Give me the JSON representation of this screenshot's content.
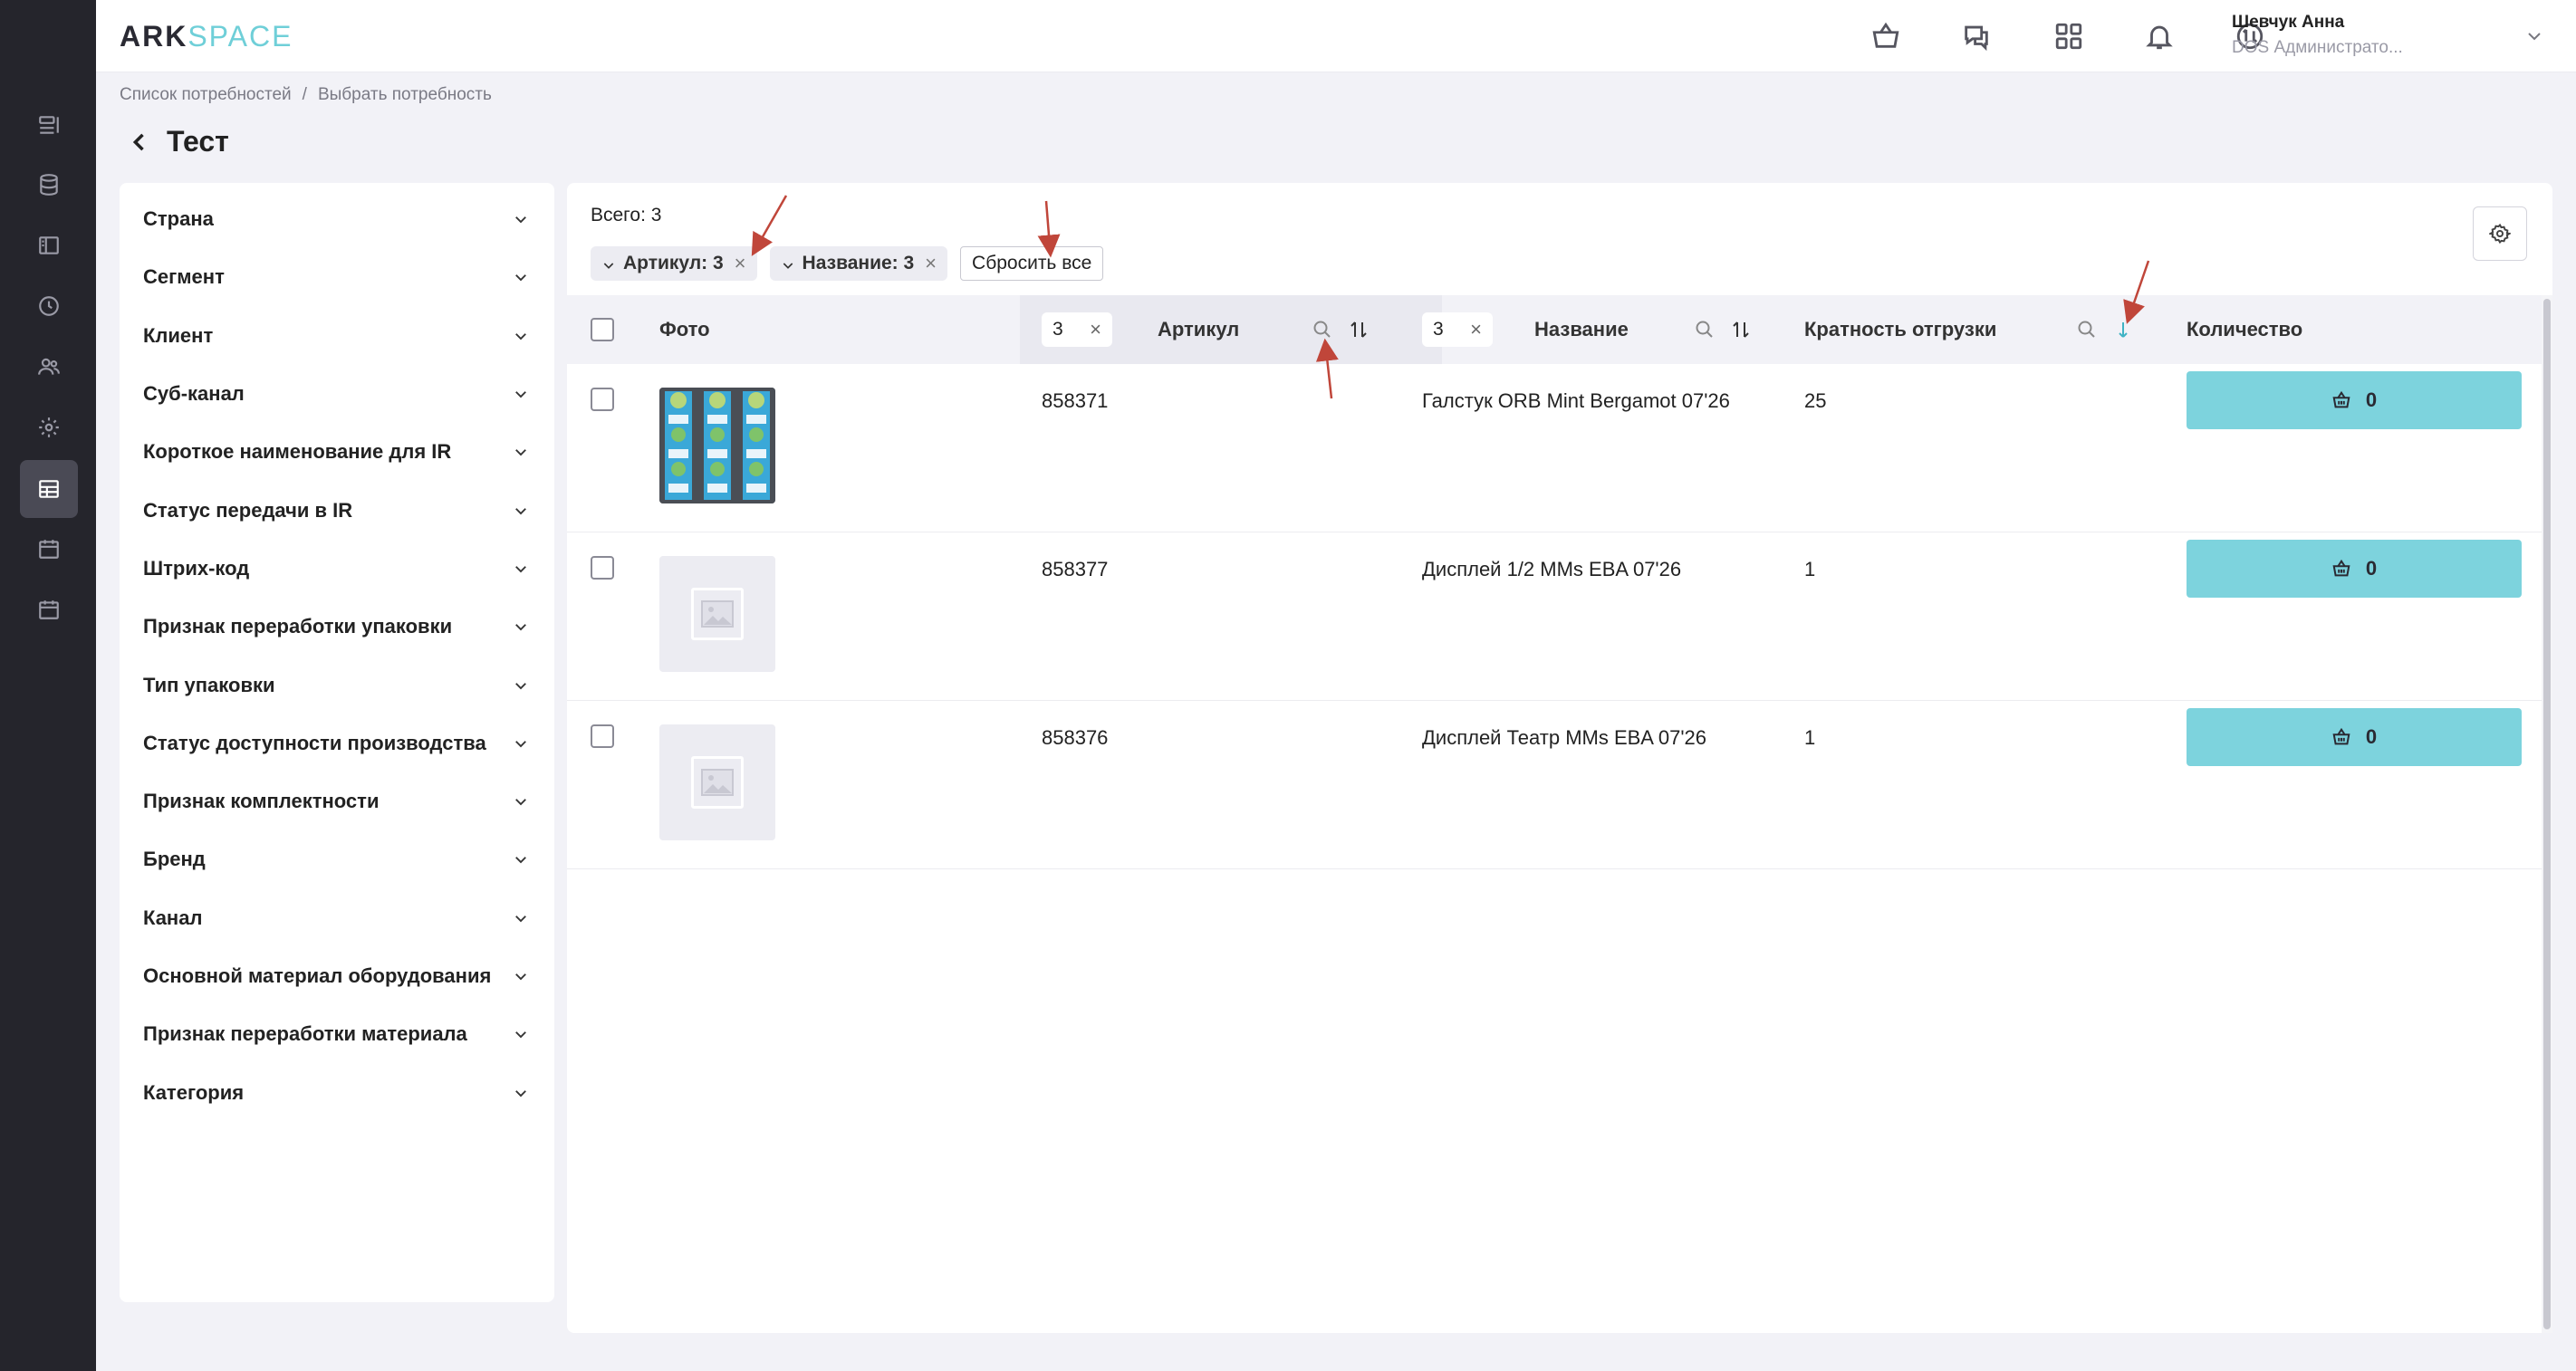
{
  "app": {
    "logo_ark": "ARK",
    "logo_space": "SPACE"
  },
  "user": {
    "name": "Шевчук Анна",
    "role": "DOS Администрато..."
  },
  "top_icons": [
    "basket-icon",
    "help-chat-icon",
    "apps-grid-icon",
    "bell-icon",
    "sync-icon"
  ],
  "rail_icons": [
    "list-icon",
    "database-icon",
    "layout-icon",
    "clock-chart-icon",
    "users-icon",
    "settings-icon",
    "table-icon",
    "calendar-icon",
    "calendar-alt-icon"
  ],
  "breadcrumb": {
    "item1": "Список потребностей",
    "separator": "/",
    "item2": "Выбрать потребность"
  },
  "page": {
    "title": "Тест"
  },
  "filters": [
    "Страна",
    "Сегмент",
    "Клиент",
    "Суб-канал",
    "Короткое наименование для IR",
    "Статус передачи в IR",
    "Штрих-код",
    "Признак переработки упаковки",
    "Тип упаковки",
    "Статус доступности производства",
    "Признак комплектности",
    "Бренд",
    "Канал",
    "Основной материал оборудования",
    "Признак переработки материала",
    "Категория"
  ],
  "summary": {
    "total": "Всего: 3",
    "chip_article": "Артикул: 3",
    "chip_name": "Название: 3",
    "reset": "Сбросить все",
    "chip_close": "×"
  },
  "table": {
    "headers": {
      "photo": "Фото",
      "article": "Артикул",
      "name": "Название",
      "multiplicity": "Кратность отгрузки",
      "quantity": "Количество"
    },
    "article_filter_value": "3",
    "name_filter_value": "3",
    "rows": [
      {
        "article": "858371",
        "name": "Галстук ORB Mint Bergamot 07'26",
        "multiplicity": "25",
        "quantity": "0",
        "has_photo": true
      },
      {
        "article": "858377",
        "name": "Дисплей 1/2 MMs EBA 07'26",
        "multiplicity": "1",
        "quantity": "0",
        "has_photo": false
      },
      {
        "article": "858376",
        "name": "Дисплей Театр MMs EBA 07'26",
        "multiplicity": "1",
        "quantity": "0",
        "has_photo": false
      }
    ]
  },
  "colors": {
    "accent": "#7dd3dd",
    "accent_dark": "#3fb3c4",
    "rail_bg": "#25252c",
    "annotation": "#c0463a"
  }
}
